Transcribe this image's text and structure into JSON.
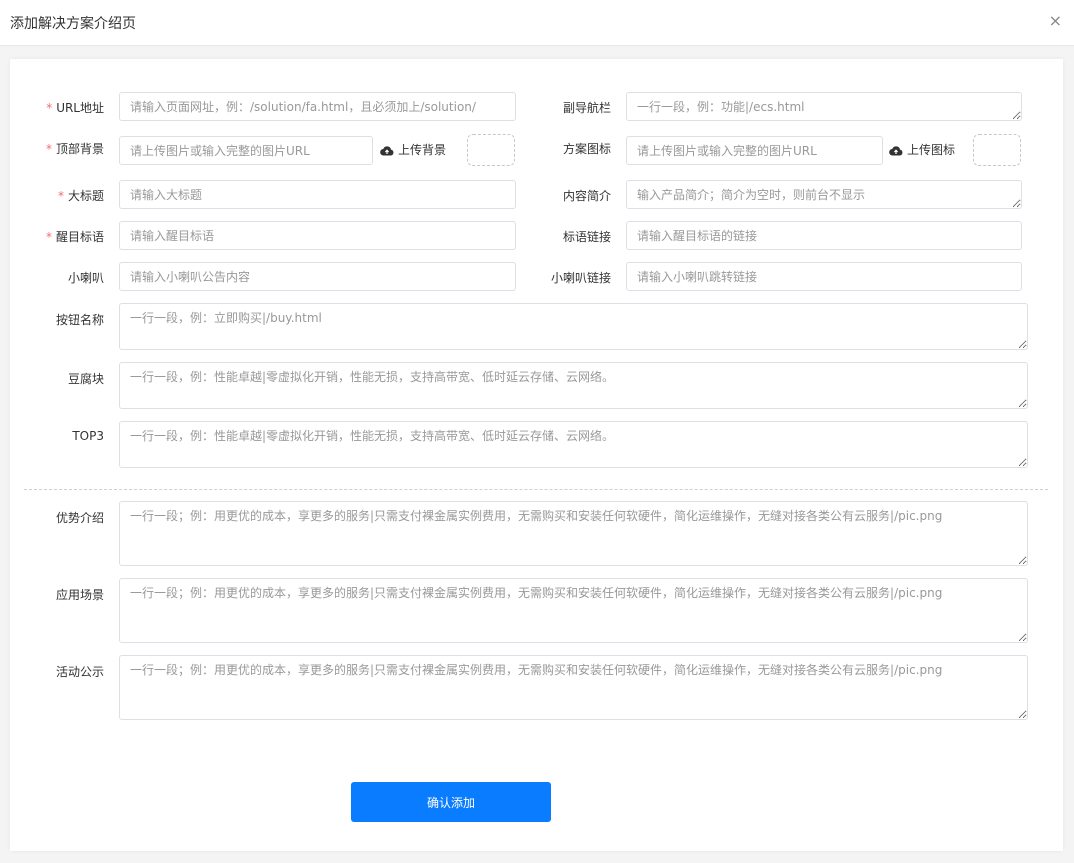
{
  "dialog": {
    "title": "添加解决方案介绍页",
    "close": "×"
  },
  "form": {
    "required_mark": "*",
    "url_label": "URL地址",
    "url_placeholder": "请输入页面网址，例：/solution/fa.html，且必须加上/solution/",
    "subnav_label": "副导航栏",
    "subnav_placeholder": "一行一段，例：功能|/ecs.html",
    "top_bg_label": "顶部背景",
    "top_bg_placeholder": "请上传图片或输入完整的图片URL",
    "top_bg_upload": "上传背景",
    "icon_label": "方案图标",
    "icon_placeholder": "请上传图片或输入完整的图片URL",
    "icon_upload": "上传图标",
    "headline_label": "大标题",
    "headline_placeholder": "请输入大标题",
    "summary_label": "内容简介",
    "summary_placeholder": "输入产品简介；简介为空时，则前台不显示",
    "slogan_label": "醒目标语",
    "slogan_placeholder": "请输入醒目标语",
    "slogan_link_label": "标语链接",
    "slogan_link_placeholder": "请输入醒目标语的链接",
    "horn_label": "小喇叭",
    "horn_placeholder": "请输入小喇叭公告内容",
    "horn_link_label": "小喇叭链接",
    "horn_link_placeholder": "请输入小喇叭跳转链接",
    "button_name_label": "按钮名称",
    "button_name_placeholder": "一行一段，例：立即购买|/buy.html",
    "tofu_label": "豆腐块",
    "tofu_placeholder": "一行一段，例：性能卓越|零虚拟化开销，性能无损，支持高带宽、低时延云存储、云网络。",
    "top3_label": "TOP3",
    "top3_placeholder": "一行一段，例：性能卓越|零虚拟化开销，性能无损，支持高带宽、低时延云存储、云网络。",
    "advantage_label": "优势介绍",
    "advantage_placeholder": "一行一段；例：用更优的成本，享更多的服务|只需支付裸金属实例费用，无需购买和安装任何软硬件，简化运维操作，无缝对接各类公有云服务|/pic.png",
    "scenario_label": "应用场景",
    "scenario_placeholder": "一行一段；例：用更优的成本，享更多的服务|只需支付裸金属实例费用，无需购买和安装任何软硬件，简化运维操作，无缝对接各类公有云服务|/pic.png",
    "activity_label": "活动公示",
    "activity_placeholder": "一行一段；例：用更优的成本，享更多的服务|只需支付裸金属实例费用，无需购买和安装任何软硬件，简化运维操作，无缝对接各类公有云服务|/pic.png",
    "submit_label": "确认添加"
  },
  "colors": {
    "accent": "#0a7cff",
    "required": "#f56c6c",
    "border": "#dcdfe6"
  },
  "icons": {
    "upload": "cloud-upload-icon",
    "close": "close-icon"
  }
}
